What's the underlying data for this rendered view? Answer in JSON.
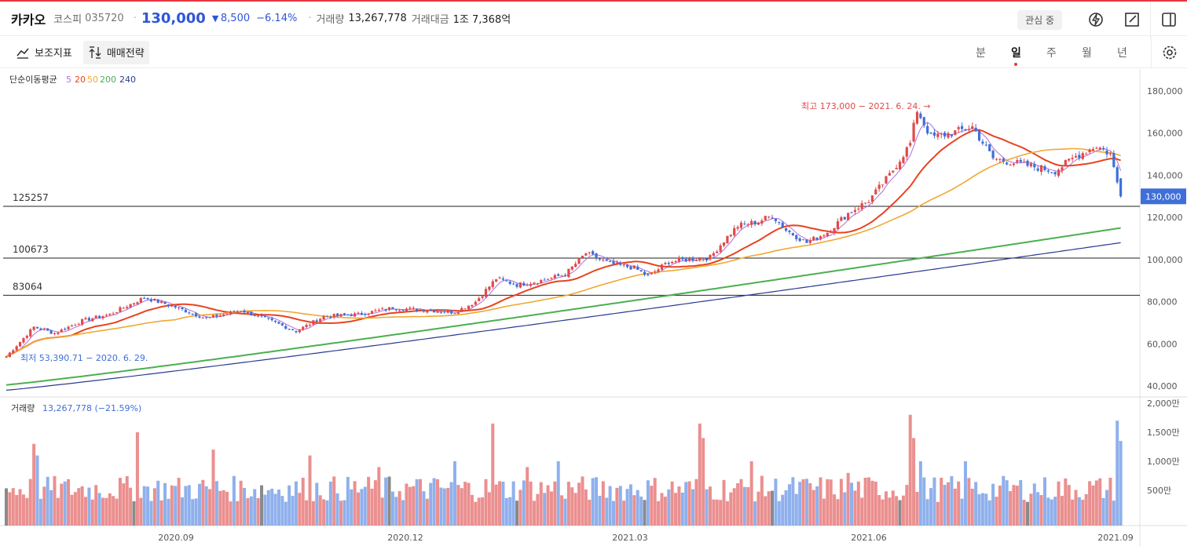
{
  "header": {
    "name": "카카오",
    "market": "코스피",
    "code": "035720",
    "price": "130,000",
    "change_arrow": "▼",
    "change": "8,500",
    "change_pct": "−6.14%",
    "volume_label": "거래량",
    "volume": "13,267,778",
    "amount_label": "거래대금",
    "amount": "1조 7,368억",
    "watch_label": "관심 중"
  },
  "toolbar": {
    "indicators_label": "보조지표",
    "strategy_label": "매매전략",
    "periods": [
      "분",
      "일",
      "주",
      "월",
      "년"
    ],
    "selected_period": "일"
  },
  "chart_data": {
    "type": "candlestick",
    "ma_legend_label": "단순이동평균",
    "ma_periods": [
      "5",
      "20",
      "50",
      "200",
      "240"
    ],
    "ma_colors": [
      "#b06fd8",
      "#e8431f",
      "#f0a832",
      "#4caf50",
      "#2b3a8f"
    ],
    "up_color": "#e04a4a",
    "down_color": "#3f6fd8",
    "y_ticks": [
      "180,000",
      "160,000",
      "140,000",
      "120,000",
      "100,000",
      "80,000",
      "60,000",
      "40,000"
    ],
    "y_range": [
      40000,
      180000
    ],
    "x_ticks": [
      "2020.09",
      "2020.12",
      "2021.03",
      "2021.06",
      "2021.09"
    ],
    "levels": [
      {
        "label": "125257",
        "value": 125257
      },
      {
        "label": "100673",
        "value": 100673
      },
      {
        "label": "83064",
        "value": 83064
      }
    ],
    "high_annotation": "최고 173,000 − 2021. 6. 24.",
    "low_annotation": "최저 53,390.71 − 2020. 6. 29.",
    "current_price_label": "130,000",
    "close_anchors": [
      [
        0,
        54000
      ],
      [
        8,
        68000
      ],
      [
        14,
        65000
      ],
      [
        22,
        71000
      ],
      [
        30,
        74000
      ],
      [
        40,
        82000
      ],
      [
        48,
        78000
      ],
      [
        58,
        72000
      ],
      [
        68,
        76000
      ],
      [
        78,
        70000
      ],
      [
        84,
        66000
      ],
      [
        92,
        73000
      ],
      [
        102,
        74000
      ],
      [
        112,
        77000
      ],
      [
        122,
        76000
      ],
      [
        130,
        75000
      ],
      [
        136,
        80000
      ],
      [
        142,
        91000
      ],
      [
        148,
        88000
      ],
      [
        155,
        90000
      ],
      [
        162,
        93000
      ],
      [
        168,
        103000
      ],
      [
        175,
        98000
      ],
      [
        182,
        96000
      ],
      [
        186,
        92000
      ],
      [
        192,
        99000
      ],
      [
        198,
        100000
      ],
      [
        204,
        101000
      ],
      [
        208,
        109000
      ],
      [
        212,
        116000
      ],
      [
        218,
        118000
      ],
      [
        222,
        121000
      ],
      [
        226,
        114000
      ],
      [
        232,
        108000
      ],
      [
        238,
        113000
      ],
      [
        244,
        122000
      ],
      [
        250,
        128000
      ],
      [
        256,
        140000
      ],
      [
        262,
        155000
      ],
      [
        264,
        171000
      ],
      [
        268,
        158000
      ],
      [
        274,
        160000
      ],
      [
        280,
        163000
      ],
      [
        286,
        148000
      ],
      [
        292,
        146000
      ],
      [
        298,
        144000
      ],
      [
        304,
        142000
      ],
      [
        310,
        149000
      ],
      [
        316,
        154000
      ],
      [
        320,
        150000
      ],
      [
        323,
        130000
      ]
    ],
    "volume_label": "거래량",
    "volume_value": "13,267,778 (−21.59%)",
    "volume_ticks": [
      "2,000만",
      "1,500만",
      "1,000만",
      "500만"
    ],
    "volume_range": [
      0,
      20000000
    ],
    "volume_spikes": [
      [
        8,
        13000000
      ],
      [
        9,
        11000000
      ],
      [
        38,
        15000000
      ],
      [
        60,
        12000000
      ],
      [
        88,
        11000000
      ],
      [
        108,
        9000000
      ],
      [
        130,
        10000000
      ],
      [
        141,
        16500000
      ],
      [
        151,
        9000000
      ],
      [
        160,
        10000000
      ],
      [
        201,
        16500000
      ],
      [
        202,
        14000000
      ],
      [
        216,
        10000000
      ],
      [
        244,
        8000000
      ],
      [
        262,
        18000000
      ],
      [
        263,
        14000000
      ],
      [
        265,
        10000000
      ],
      [
        278,
        10000000
      ],
      [
        322,
        17000000
      ],
      [
        323,
        13500000
      ]
    ]
  }
}
